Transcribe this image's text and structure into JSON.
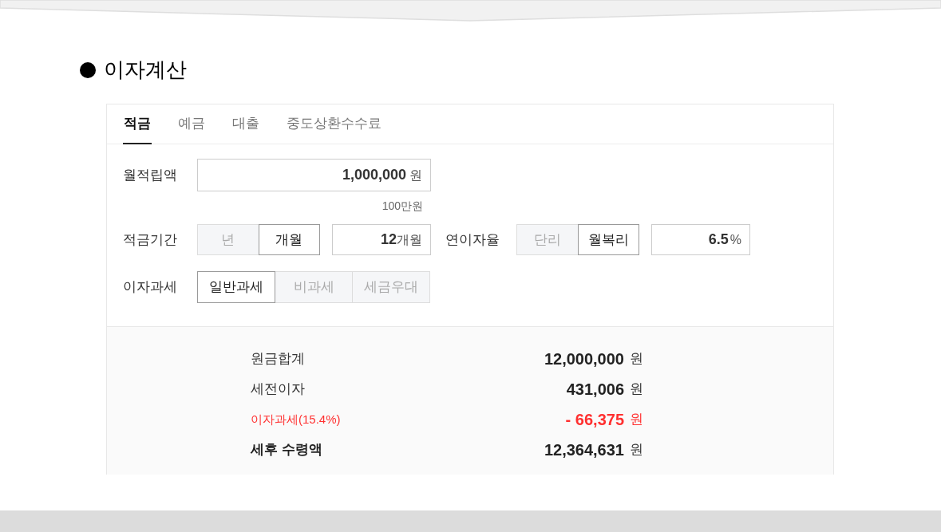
{
  "title": "이자계산",
  "tabs": [
    {
      "label": "적금",
      "selected": true
    },
    {
      "label": "예금",
      "selected": false
    },
    {
      "label": "대출",
      "selected": false
    },
    {
      "label": "중도상환수수료",
      "selected": false
    }
  ],
  "monthly_deposit": {
    "label": "월적립액",
    "value": "1,000,000",
    "unit": "원",
    "hint": "100만원"
  },
  "period": {
    "label": "적금기간",
    "options": [
      {
        "label": "년",
        "selected": false
      },
      {
        "label": "개월",
        "selected": true
      }
    ],
    "value": "12",
    "unit": "개월"
  },
  "rate": {
    "label": "연이자율",
    "options": [
      {
        "label": "단리",
        "selected": false
      },
      {
        "label": "월복리",
        "selected": true
      }
    ],
    "value": "6.5",
    "unit": "%"
  },
  "taxation": {
    "label": "이자과세",
    "options": [
      {
        "label": "일반과세",
        "selected": true
      },
      {
        "label": "비과세",
        "selected": false
      },
      {
        "label": "세금우대",
        "selected": false
      }
    ]
  },
  "results": [
    {
      "kind": "normal",
      "label": "원금합계",
      "value": "12,000,000",
      "unit": "원"
    },
    {
      "kind": "normal",
      "label": "세전이자",
      "value": "431,006",
      "unit": "원"
    },
    {
      "kind": "deduction",
      "label": "이자과세(15.4%)",
      "value": "- 66,375",
      "unit": "원"
    },
    {
      "kind": "total",
      "label": "세후 수령액",
      "value": "12,364,631",
      "unit": "원"
    }
  ]
}
